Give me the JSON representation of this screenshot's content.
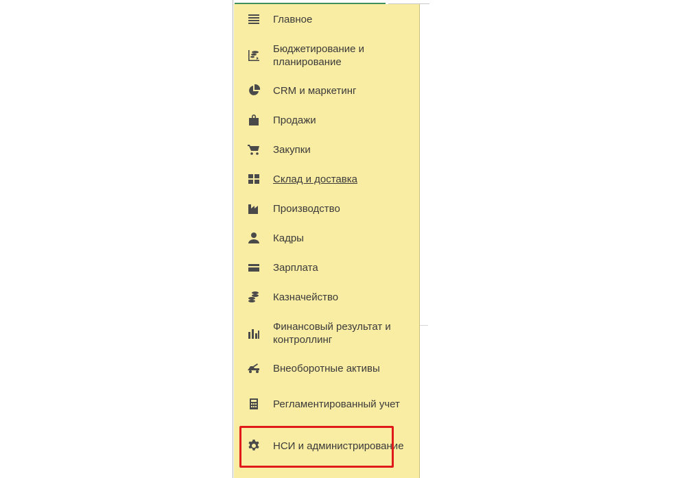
{
  "sections_panel": {
    "items": [
      {
        "label": "Главное",
        "icon": "list-icon"
      },
      {
        "label": "Бюджетирование и планирование",
        "icon": "budget-chart-icon"
      },
      {
        "label": "CRM и маркетинг",
        "icon": "pie-chart-icon"
      },
      {
        "label": "Продажи",
        "icon": "shopping-bag-icon"
      },
      {
        "label": "Закупки",
        "icon": "cart-icon"
      },
      {
        "label": "Склад и доставка",
        "icon": "warehouse-grid-icon",
        "underlined": true
      },
      {
        "label": "Производство",
        "icon": "factory-icon"
      },
      {
        "label": "Кадры",
        "icon": "person-icon"
      },
      {
        "label": "Зарплата",
        "icon": "wallet-card-icon"
      },
      {
        "label": "Казначейство",
        "icon": "coins-icon"
      },
      {
        "label": "Финансовый результат и контроллинг",
        "icon": "bar-chart-icon"
      },
      {
        "label": "Внеоборотные активы",
        "icon": "truck-icon"
      },
      {
        "label": "Регламентированный учет",
        "icon": "calculator-icon"
      },
      {
        "label": "НСИ и администрирование",
        "icon": "gear-icon",
        "highlighted": true
      }
    ]
  },
  "colors": {
    "panel_background": "#f9eca3",
    "highlight_border": "#e0191b",
    "text": "#3a3a3a"
  }
}
